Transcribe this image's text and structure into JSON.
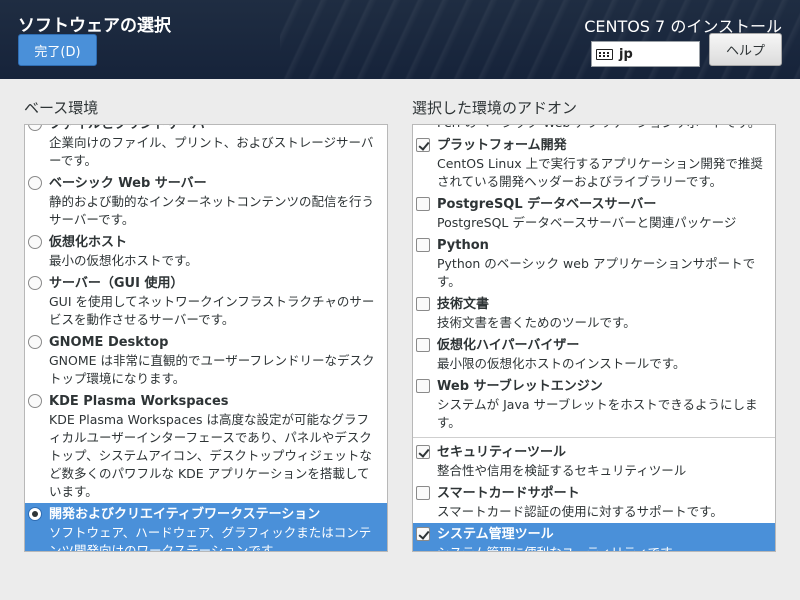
{
  "header": {
    "title": "ソフトウェアの選択",
    "done_label": "完了(D)",
    "product": "CENTOS 7 のインストール",
    "keyboard_layout": "jp",
    "help_label": "ヘルプ"
  },
  "base": {
    "title": "ベース環境",
    "items": [
      {
        "name": "ファイルとプリントサーバー",
        "desc": "企業向けのファイル、プリント、およびストレージサーバーです。",
        "selected": false
      },
      {
        "name": "ベーシック Web サーバー",
        "desc": "静的および動的なインターネットコンテンツの配信を行うサーバーです。",
        "selected": false
      },
      {
        "name": "仮想化ホスト",
        "desc": "最小の仮想化ホストです。",
        "selected": false
      },
      {
        "name": "サーバー（GUI 使用）",
        "desc": "GUI を使用してネットワークインフラストラクチャのサービスを動作させるサーバーです。",
        "selected": false
      },
      {
        "name": "GNOME Desktop",
        "desc": "GNOME は非常に直観的でユーザーフレンドリーなデスクトップ環境になります。",
        "selected": false
      },
      {
        "name": "KDE Plasma Workspaces",
        "desc": "KDE Plasma Workspaces は高度な設定が可能なグラフィカルユーザーインターフェースであり、パネルやデスクトップ、システムアイコン、デスクトップウィジェットなど数多くのパワフルな KDE アプリケーションを搭載しています。",
        "selected": false
      },
      {
        "name": "開発およびクリエイティブワークステーション",
        "desc": "ソフトウェア、ハードウェア、グラフィックまたはコンテンツ開発向けのワークステーションです。",
        "selected": true
      }
    ]
  },
  "addons": {
    "title": "選択した環境のアドオン",
    "items": [
      {
        "name": "",
        "desc": "Perl のベーシック Web アプリケーションサポートです。",
        "checked": false,
        "partial": true
      },
      {
        "name": "プラットフォーム開発",
        "desc": "CentOS Linux 上で実行するアプリケーション開発で推奨されている開発ヘッダーおよびライブラリーです。",
        "checked": true
      },
      {
        "name": "PostgreSQL データベースサーバー",
        "desc": "PostgreSQL データベースサーバーと関連パッケージ",
        "checked": false
      },
      {
        "name": "Python",
        "desc": "Python のベーシック web アプリケーションサポートです。",
        "checked": false
      },
      {
        "name": "技術文書",
        "desc": "技術文書を書くためのツールです。",
        "checked": false
      },
      {
        "name": "仮想化ハイパーバイザー",
        "desc": "最小限の仮想化ホストのインストールです。",
        "checked": false
      },
      {
        "name": "Web サーブレットエンジン",
        "desc": "システムが Java サーブレットをホストできるようにします。",
        "checked": false
      },
      {
        "separator": true
      },
      {
        "name": "セキュリティーツール",
        "desc": "整合性や信用を検証するセキュリティツール",
        "checked": true
      },
      {
        "name": "スマートカードサポート",
        "desc": "スマートカード認証の使用に対するサポートです。",
        "checked": false
      },
      {
        "name": "システム管理ツール",
        "desc": "システム管理に便利なユーティリティです。",
        "checked": true,
        "selected": true
      }
    ]
  },
  "colors": {
    "accent": "#4a90d9",
    "header_bg": "#1f2d42"
  }
}
